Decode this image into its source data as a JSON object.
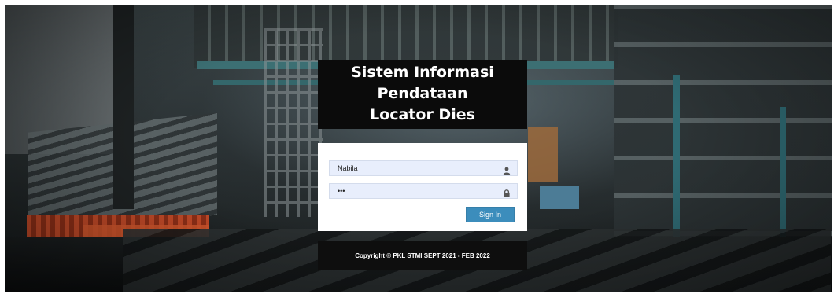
{
  "title_lines": [
    "Sistem Informasi",
    "Pendataan",
    "Locator Dies"
  ],
  "login": {
    "username_value": "Nabila",
    "password_value": "•••",
    "username_icon": "user-icon",
    "password_icon": "lock-icon",
    "signin_label": "Sign In"
  },
  "footer": {
    "copyright": "Copyright © PKL STMI SEPT 2021 - FEB 2022"
  },
  "colors": {
    "title_bg": "#0b0b0b",
    "field_bg": "#e8eefc",
    "button_bg": "#3c8dbc",
    "footer_bg": "#0e0e0e"
  }
}
